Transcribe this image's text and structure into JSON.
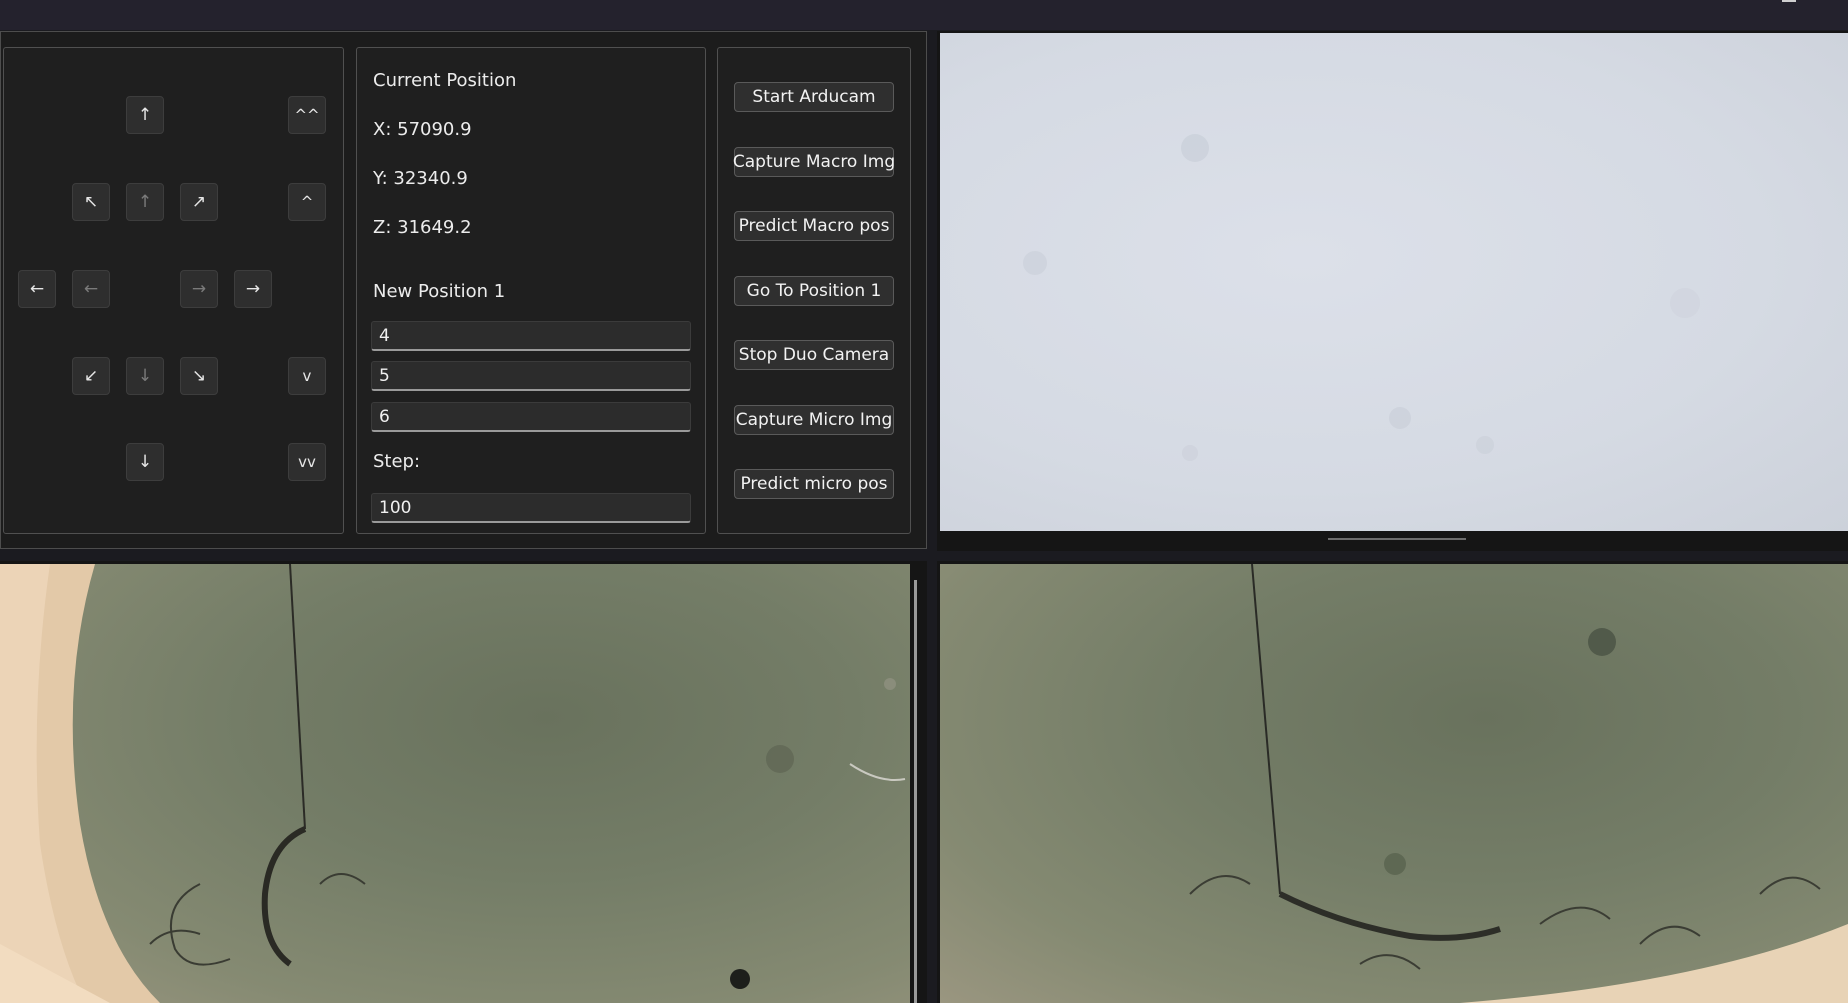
{
  "window": {
    "minimize_icon": "minimize-icon"
  },
  "jog": {
    "up_label": "↑",
    "z_up_fast_label": "^^",
    "up_left_label": "↖",
    "up_small_label": "↑",
    "up_right_label": "↗",
    "z_up_label": "^",
    "left_label": "←",
    "left_small_label": "←",
    "right_small_label": "→",
    "right_label": "→",
    "down_left_label": "↙",
    "down_small_label": "↓",
    "down_right_label": "↘",
    "z_down_label": "v",
    "down_label": "↓",
    "z_down_fast_label": "vv"
  },
  "position": {
    "current_label": "Current Position",
    "x": "X: 57090.9",
    "y": "Y: 32340.9",
    "z": "Z: 31649.2",
    "new_label": "New Position 1",
    "new_x": "4",
    "new_y": "5",
    "new_z": "6",
    "step_label": "Step:",
    "step_value": "100"
  },
  "actions": {
    "start_arducam": "Start Arducam",
    "capture_macro": "Capture Macro Img",
    "predict_macro": "Predict Macro pos",
    "go_to_position": "Go To Position 1",
    "stop_duo_camera": "Stop Duo Camera",
    "capture_micro": "Capture Micro Img",
    "predict_micro": "Predict micro pos"
  }
}
